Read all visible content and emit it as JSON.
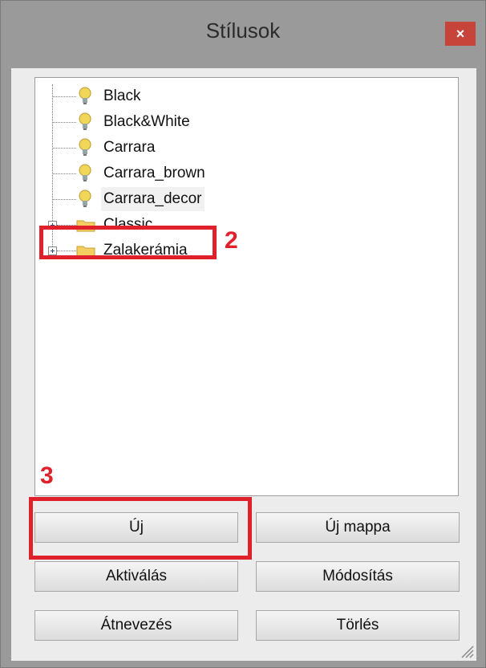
{
  "window": {
    "title": "Stílusok",
    "close_label": "×"
  },
  "tree": {
    "items": [
      {
        "label": "Black",
        "icon": "bulb-icon"
      },
      {
        "label": "Black&White",
        "icon": "bulb-icon"
      },
      {
        "label": "Carrara",
        "icon": "bulb-icon"
      },
      {
        "label": "Carrara_brown",
        "icon": "bulb-icon"
      },
      {
        "label": "Carrara_decor",
        "icon": "bulb-icon",
        "selected": true
      },
      {
        "label": "Classic",
        "icon": "folder-icon",
        "expandable": true
      },
      {
        "label": "Zalakerámia",
        "icon": "folder-icon",
        "expandable": true
      }
    ]
  },
  "buttons": {
    "new": "Új",
    "new_folder": "Új mappa",
    "activate": "Aktiválás",
    "modify": "Módosítás",
    "rename": "Átnevezés",
    "delete": "Törlés"
  },
  "annotations": {
    "step2": "2",
    "step3": "3"
  },
  "colors": {
    "highlight": "#e0202a",
    "close": "#c7443a",
    "bulb": "#f0d75a",
    "folder": "#f3cf63"
  }
}
